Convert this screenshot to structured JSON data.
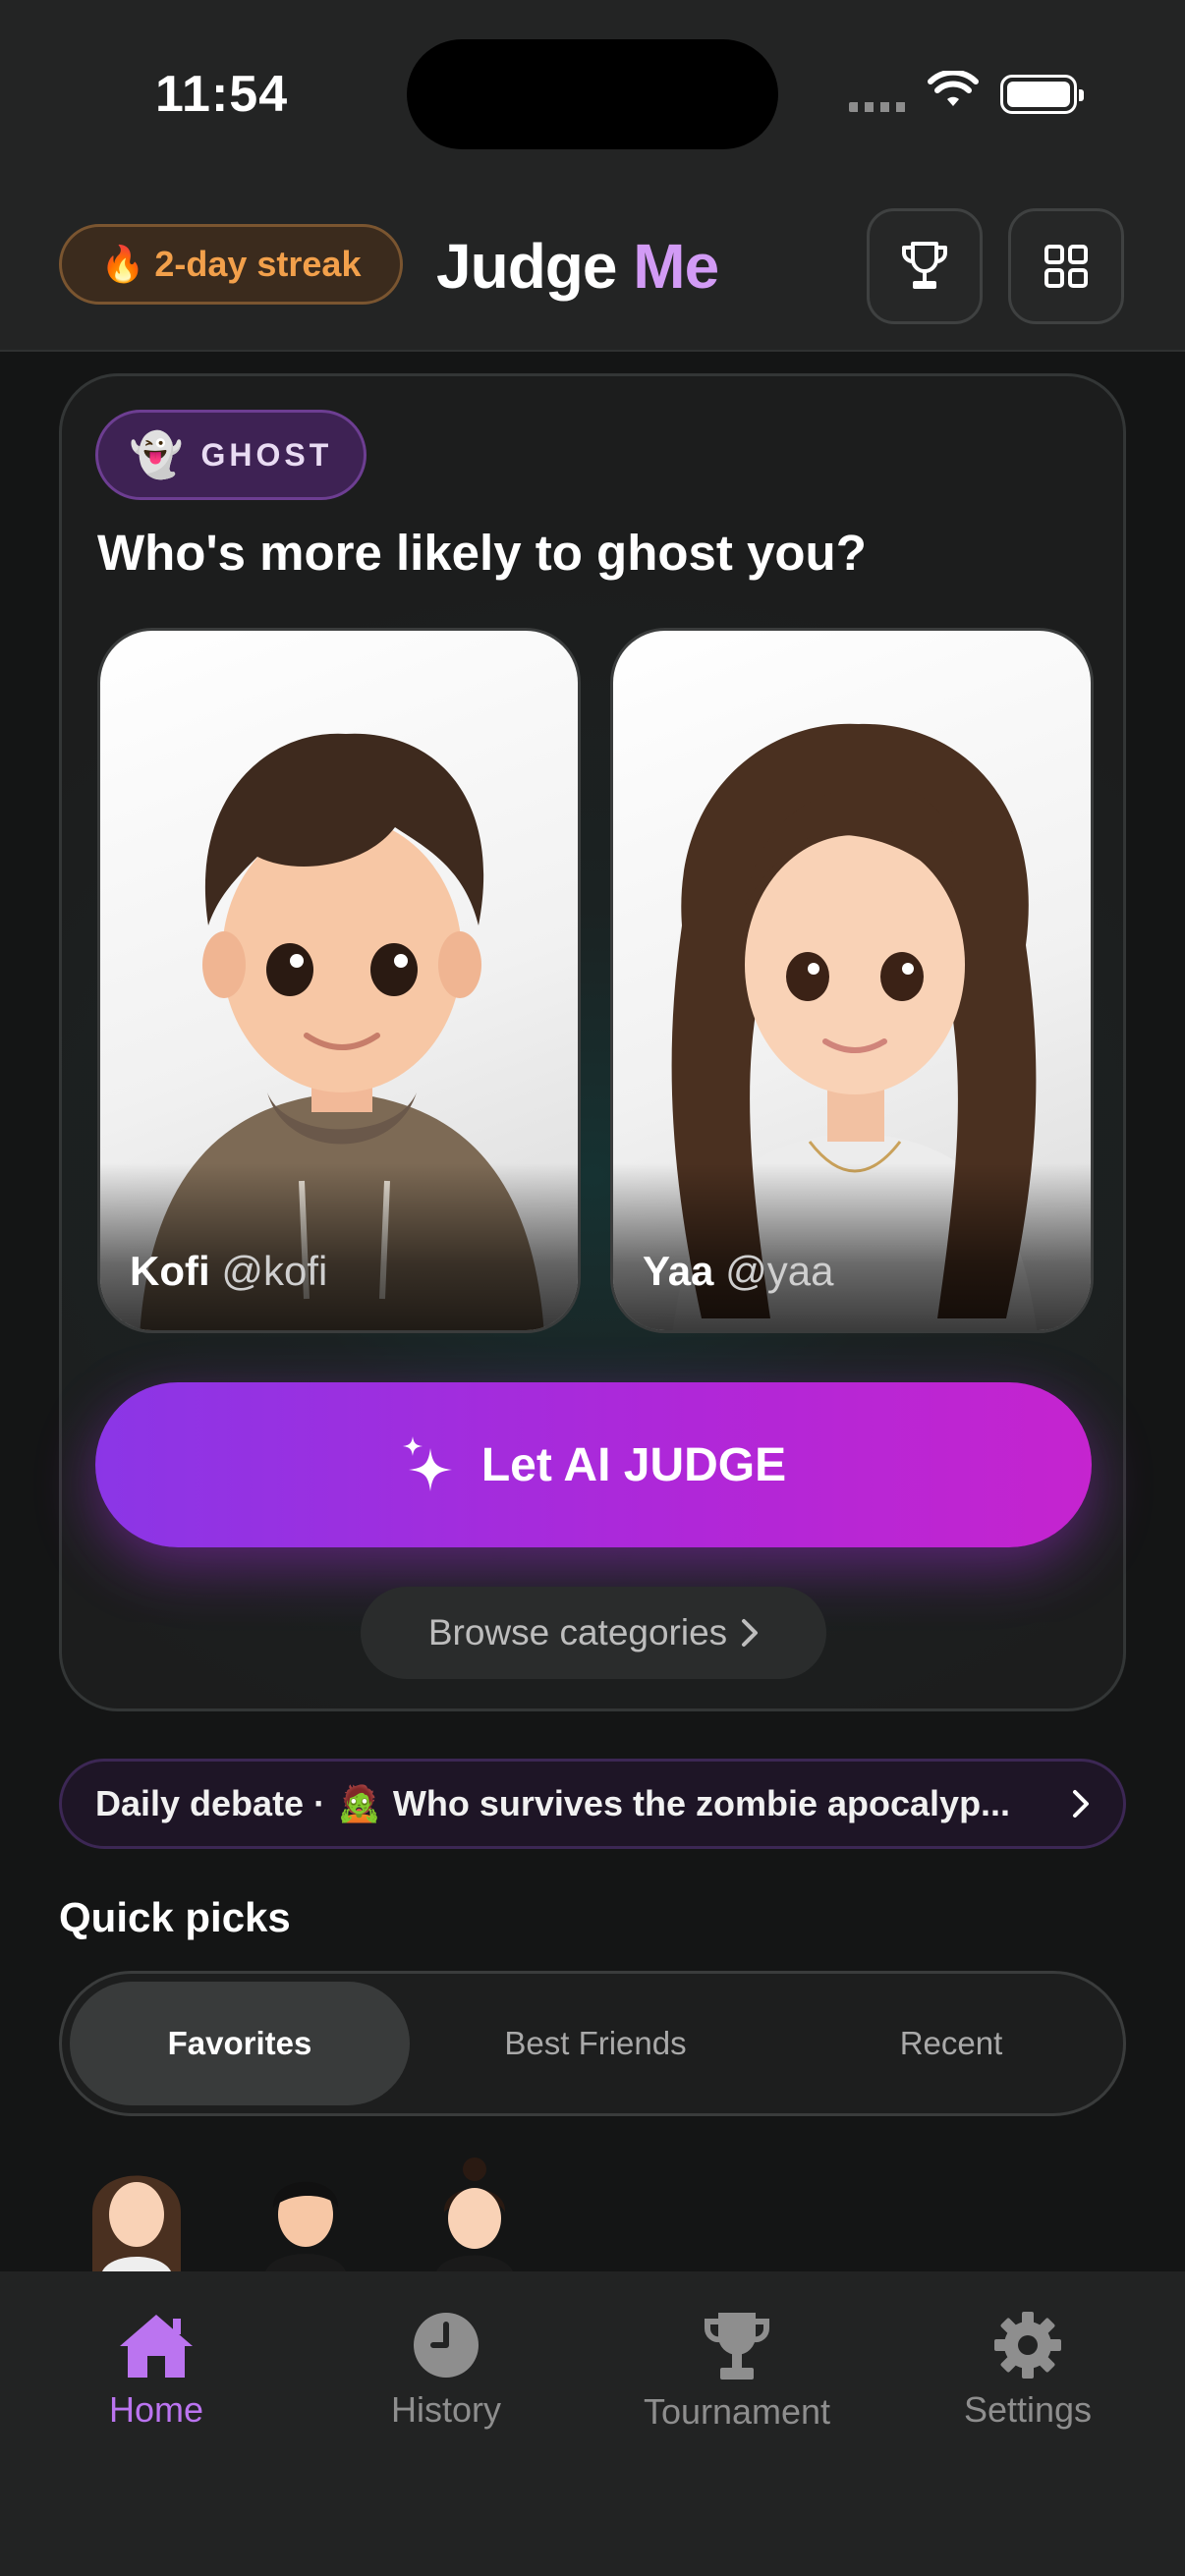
{
  "status": {
    "time": "11:54"
  },
  "header": {
    "streak_label": "2-day streak",
    "brand_part1": "Judge",
    "brand_part2": "Me",
    "brand_accent": "#d29bf5"
  },
  "card": {
    "category_badge": "GHOST",
    "category_emoji": "👻",
    "question": "Who's more likely to ghost you?",
    "candidates": [
      {
        "name": "Kofi",
        "handle": "@kofi"
      },
      {
        "name": "Yaa",
        "handle": "@yaa"
      }
    ],
    "judge_button": "Let AI JUDGE",
    "browse_button": "Browse categories"
  },
  "daily_debate": {
    "prefix": "Daily debate ·",
    "emoji": "🧟",
    "text": "Who survives the zombie apocalyp..."
  },
  "quick_picks": {
    "title": "Quick picks",
    "tabs": [
      "Favorites",
      "Best Friends",
      "Recent"
    ],
    "active_tab": "Favorites"
  },
  "tabbar": {
    "items": [
      {
        "label": "Home",
        "icon": "home-icon",
        "active": true
      },
      {
        "label": "History",
        "icon": "history-icon",
        "active": false
      },
      {
        "label": "Tournament",
        "icon": "trophy-icon",
        "active": false
      },
      {
        "label": "Settings",
        "icon": "gear-icon",
        "active": false
      }
    ],
    "active_color": "#bb74f0"
  }
}
